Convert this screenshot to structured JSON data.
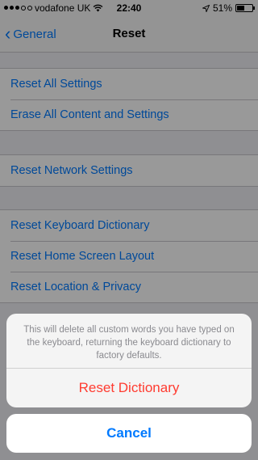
{
  "status_bar": {
    "carrier": "vodafone UK",
    "time": "22:40",
    "battery": "51%",
    "battery_level": 0.51
  },
  "nav": {
    "back_label": "General",
    "title": "Reset"
  },
  "settings": {
    "group1": [
      "Reset All Settings",
      "Erase All Content and Settings"
    ],
    "group2": [
      "Reset Network Settings"
    ],
    "group3": [
      "Reset Keyboard Dictionary",
      "Reset Home Screen Layout",
      "Reset Location & Privacy"
    ]
  },
  "action_sheet": {
    "message": "This will delete all custom words you have typed on the keyboard, returning the keyboard dictionary to factory defaults.",
    "destructive_label": "Reset Dictionary",
    "cancel_label": "Cancel"
  },
  "colors": {
    "accent": "#007aff",
    "destructive": "#ff3b30"
  }
}
